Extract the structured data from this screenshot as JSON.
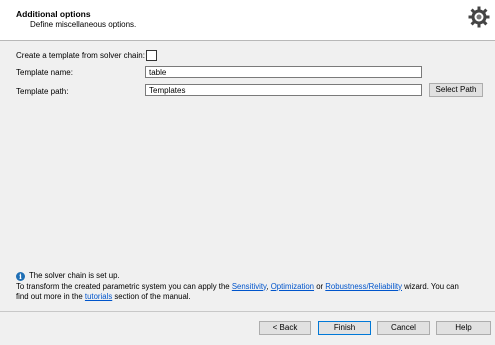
{
  "header": {
    "title": "Additional options",
    "subtitle": "Define miscellaneous options."
  },
  "form": {
    "template_checkbox_label": "Create a template from solver chain:",
    "template_checkbox_checked": false,
    "template_name_label": "Template name:",
    "template_name_value": "table",
    "template_path_label": "Template path:",
    "template_path_value": "Templates",
    "select_path_label": "Select Path"
  },
  "info": {
    "line1": "The solver chain is set up.",
    "line2_prefix": "To transform the created parametric system you can apply the ",
    "link_sensitivity": "Sensitivity",
    "sep1": ", ",
    "link_optimization": "Optimization",
    "sep2": " or ",
    "link_robustness": "Robustness/Reliability",
    "line2_suffix": " wizard. You can",
    "line3_prefix": "find out more in the ",
    "link_tutorials": "tutorials",
    "line3_suffix": " section of the manual."
  },
  "footer": {
    "back_label": "< Back",
    "finish_label": "Finish",
    "cancel_label": "Cancel",
    "help_label": "Help"
  },
  "icons": {
    "header_icon": "gear-icon",
    "info_icon": "info-icon"
  }
}
